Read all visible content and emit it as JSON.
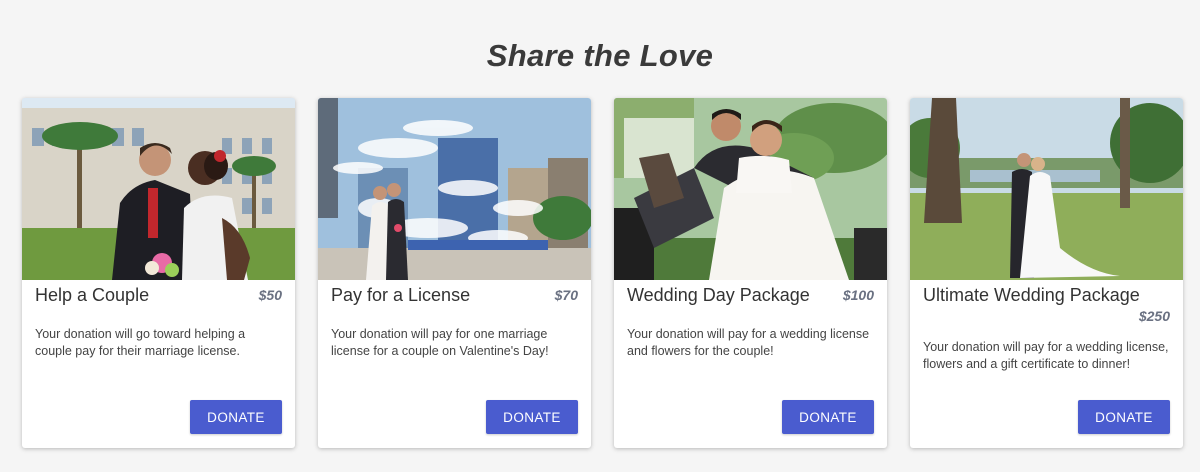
{
  "page": {
    "title": "Share the Love"
  },
  "cards": [
    {
      "title": "Help a Couple",
      "price": "$50",
      "description": "Your donation will go toward helping a couple pay for their marriage license.",
      "button_label": "DONATE",
      "photo": "couple-kissing-outdoors-photo"
    },
    {
      "title": "Pay for a License",
      "price": "$70",
      "description": "Your donation will pay for one marriage license for a couple on Valentine's Day!",
      "button_label": "DONATE",
      "photo": "couple-kissing-by-fountain-photo"
    },
    {
      "title": "Wedding Day Package",
      "price": "$100",
      "description": "Your donation will pay for a wedding license and flowers for the couple!",
      "button_label": "DONATE",
      "photo": "bride-groom-on-bench-photo"
    },
    {
      "title": "Ultimate Wedding Package",
      "price": "$250",
      "description": "Your donation will pay for a wedding license, flowers and a gift certificate to dinner!",
      "button_label": "DONATE",
      "photo": "couple-kissing-in-park-photo"
    }
  ],
  "colors": {
    "background": "#f5f5f5",
    "card": "#ffffff",
    "button": "#4a5ccf",
    "price": "#6a7182"
  }
}
